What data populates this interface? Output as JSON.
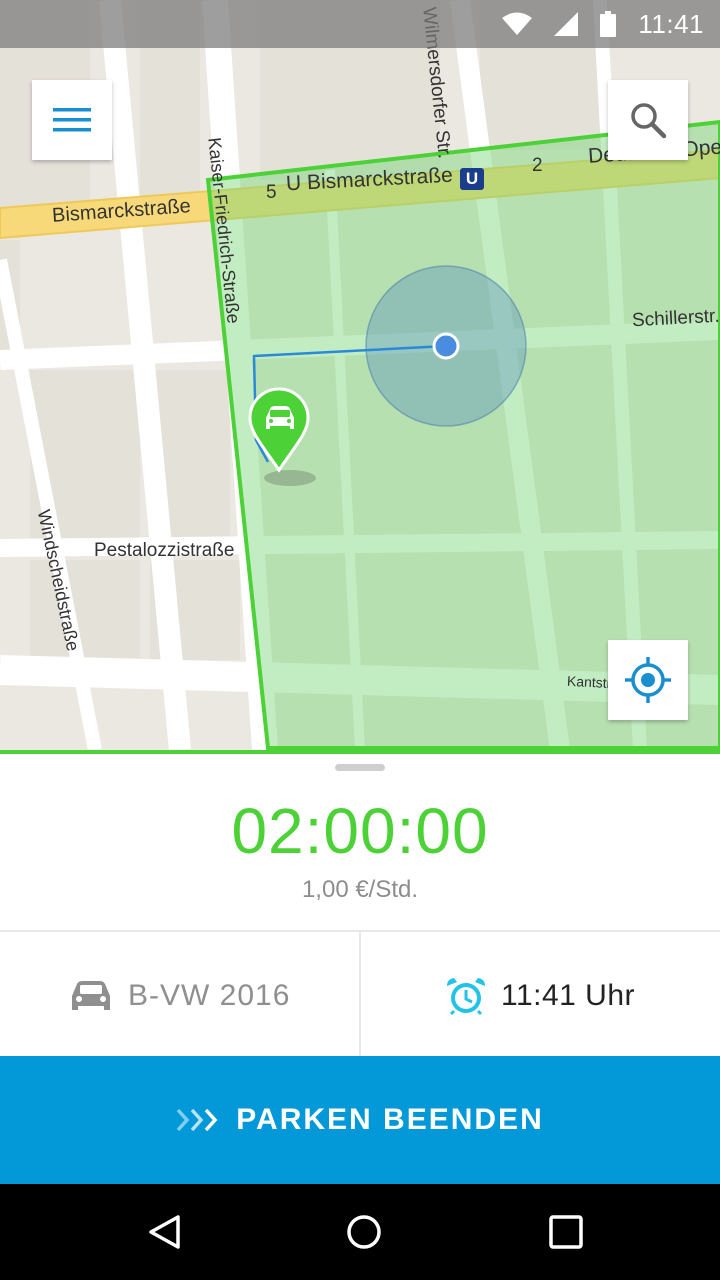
{
  "status_bar": {
    "time": "11:41"
  },
  "map": {
    "streets": {
      "bismarck": "Bismarckstraße",
      "station": "U Bismarckstraße",
      "station_badge": "U",
      "num_5": "5",
      "num_2": "2",
      "wilmersdorfer": "Wilmersdorfer Str.",
      "kaiser": "Kaiser-Friedrich-Straße",
      "schiller": "Schillerstr.",
      "windscheid": "Windscheidstraße",
      "pestalozzi": "Pestalozzistraße",
      "kant": "Kantstr.",
      "oper": "Deutsche Oper"
    }
  },
  "parking": {
    "timer": "02:00:00",
    "rate": "1,00 €/Std.",
    "plate": "B-VW 2016",
    "end_time": "11:41 Uhr"
  },
  "action": {
    "label": "PARKEN BEENDEN"
  },
  "colors": {
    "accent_green": "#4cd137",
    "primary_blue": "#0398d8"
  }
}
